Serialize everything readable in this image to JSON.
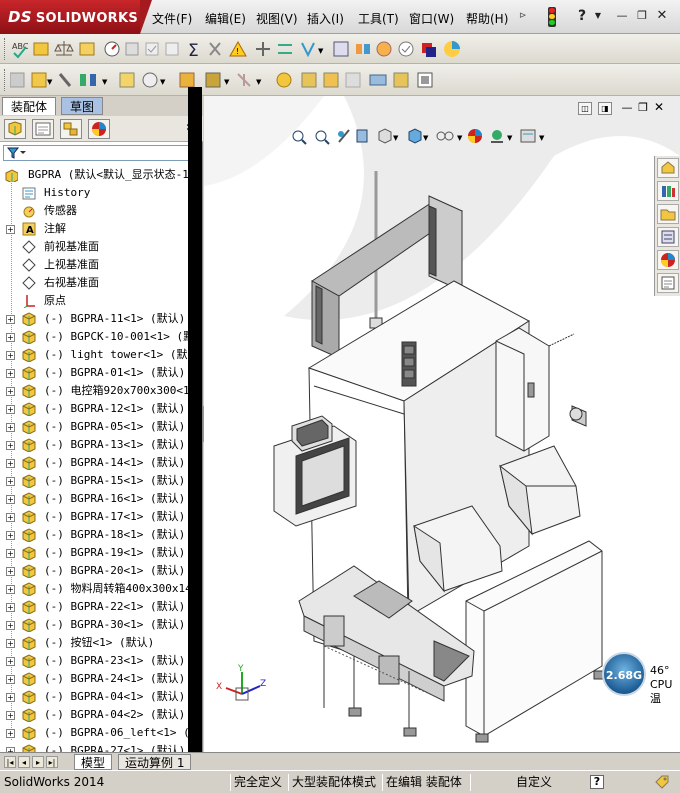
{
  "app": {
    "logo_prefix": "DS",
    "logo_text": "SOLIDWORKS"
  },
  "menu": [
    "文件(F)",
    "编辑(E)",
    "视图(V)",
    "插入(I)",
    "工具(T)",
    "窗口(W)",
    "帮助(H)"
  ],
  "left_tabs": {
    "assembly": "装配体",
    "sketch": "草图"
  },
  "tree": {
    "root": "BGPRA  (默认<默认_显示状态-1>)",
    "items": [
      {
        "label": "History",
        "icon": "history-icon",
        "expand": false
      },
      {
        "label": "传感器",
        "icon": "sensor-icon",
        "expand": false
      },
      {
        "label": "注解",
        "icon": "annotation-icon",
        "expand": true
      },
      {
        "label": "前视基准面",
        "icon": "plane-icon",
        "expand": false
      },
      {
        "label": "上视基准面",
        "icon": "plane-icon",
        "expand": false
      },
      {
        "label": "右视基准面",
        "icon": "plane-icon",
        "expand": false
      },
      {
        "label": "原点",
        "icon": "origin-icon",
        "expand": false
      },
      {
        "label": "(-) BGPRA-11<1> (默认)",
        "icon": "assembly-icon",
        "expand": true
      },
      {
        "label": "(-) BGPCK-10-001<1> (默认)",
        "icon": "assembly-icon",
        "expand": true
      },
      {
        "label": "(-) light tower<1> (默认)",
        "icon": "assembly-icon",
        "expand": true
      },
      {
        "label": "(-) BGPRA-01<1> (默认)",
        "icon": "assembly-icon",
        "expand": true
      },
      {
        "label": "(-) 电控箱920x700x300<1> (默",
        "icon": "assembly-icon",
        "expand": true
      },
      {
        "label": "(-) BGPRA-12<1> (默认)",
        "icon": "assembly-icon",
        "expand": true
      },
      {
        "label": "(-) BGPRA-05<1> (默认)",
        "icon": "assembly-icon",
        "expand": true
      },
      {
        "label": "(-) BGPRA-13<1> (默认)",
        "icon": "assembly-icon",
        "expand": true
      },
      {
        "label": "(-) BGPRA-14<1> (默认)",
        "icon": "assembly-icon",
        "expand": true
      },
      {
        "label": "(-) BGPRA-15<1> (默认)",
        "icon": "assembly-icon",
        "expand": true
      },
      {
        "label": "(-) BGPRA-16<1> (默认)",
        "icon": "assembly-icon",
        "expand": true
      },
      {
        "label": "(-) BGPRA-17<1> (默认)",
        "icon": "assembly-icon",
        "expand": true
      },
      {
        "label": "(-) BGPRA-18<1> (默认)",
        "icon": "assembly-icon",
        "expand": true
      },
      {
        "label": "(-) BGPRA-19<1> (默认)",
        "icon": "assembly-icon",
        "expand": true
      },
      {
        "label": "(-) BGPRA-20<1> (默认)",
        "icon": "assembly-icon",
        "expand": true
      },
      {
        "label": "(-) 物料周转箱400x300x148<",
        "icon": "assembly-icon",
        "expand": true
      },
      {
        "label": "(-) BGPRA-22<1> (默认)",
        "icon": "assembly-icon",
        "expand": true
      },
      {
        "label": "(-) BGPRA-30<1> (默认)",
        "icon": "assembly-icon",
        "expand": true
      },
      {
        "label": "(-) 按钮<1> (默认)",
        "icon": "assembly-icon",
        "expand": true
      },
      {
        "label": "(-) BGPRA-23<1> (默认)",
        "icon": "assembly-icon",
        "expand": true
      },
      {
        "label": "(-) BGPRA-24<1> (默认)",
        "icon": "assembly-icon",
        "expand": true
      },
      {
        "label": "(-) BGPRA-04<1> (默认)",
        "icon": "assembly-icon",
        "expand": true
      },
      {
        "label": "(-) BGPRA-04<2> (默认)",
        "icon": "assembly-icon",
        "expand": true
      },
      {
        "label": "(-) BGPRA-06_left<1> (默认)",
        "icon": "assembly-icon",
        "expand": true
      },
      {
        "label": "(-) BGPRA-27<1> (默认)",
        "icon": "assembly-icon",
        "expand": true
      }
    ]
  },
  "bottom_tabs": {
    "model": "模型",
    "motion": "运动算例 1"
  },
  "status": {
    "app_version": "SolidWorks 2014",
    "defined": "完全定义",
    "mode": "大型装配体模式",
    "editing": "在编辑 装配体",
    "custom": "自定义"
  },
  "cpu": {
    "freq": "2.68G",
    "temp": "46°",
    "label": "CPU温"
  },
  "colors": {
    "brand": "#b01d22",
    "panel": "#d4d0c8",
    "tree_highlight": "#a9c1e2"
  }
}
